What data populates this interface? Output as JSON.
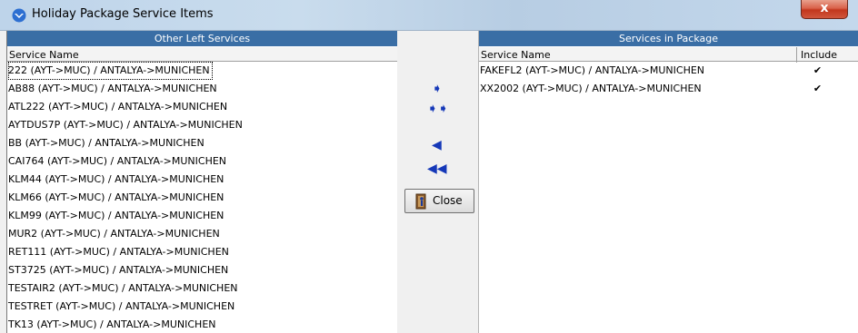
{
  "window": {
    "title": "Holiday Package Service Items",
    "close_glyph": "x"
  },
  "left_panel": {
    "group_title": "Other Left Services",
    "column_header": "Service Name",
    "rows": [
      "222 (AYT->MUC) / ANTALYA->MUNICHEN",
      "AB88 (AYT->MUC) / ANTALYA->MUNICHEN",
      "ATL222 (AYT->MUC) / ANTALYA->MUNICHEN",
      "AYTDUS7P (AYT->MUC) / ANTALYA->MUNICHEN",
      "BB (AYT->MUC) / ANTALYA->MUNICHEN",
      "CAI764 (AYT->MUC) / ANTALYA->MUNICHEN",
      "KLM44 (AYT->MUC) / ANTALYA->MUNICHEN",
      "KLM66 (AYT->MUC) / ANTALYA->MUNICHEN",
      "KLM99 (AYT->MUC) / ANTALYA->MUNICHEN",
      "MUR2 (AYT->MUC) / ANTALYA->MUNICHEN",
      "RET111 (AYT->MUC) / ANTALYA->MUNICHEN",
      "ST3725 (AYT->MUC) / ANTALYA->MUNICHEN",
      "TESTAIR2 (AYT->MUC) / ANTALYA->MUNICHEN",
      "TESTRET (AYT->MUC) / ANTALYA->MUNICHEN",
      "TK13 (AYT->MUC) / ANTALYA->MUNICHEN"
    ]
  },
  "right_panel": {
    "group_title": "Services in Package",
    "column_service": "Service Name",
    "column_include": "Include",
    "rows": [
      {
        "name": "FAKEFL2 (AYT->MUC) / ANTALYA->MUNICHEN",
        "include": "✔"
      },
      {
        "name": "XX2002 (AYT->MUC) / ANTALYA->MUNICHEN",
        "include": "✔"
      }
    ]
  },
  "buttons": {
    "add_one": "➧",
    "add_all": "➧➧",
    "remove_one": "◀",
    "remove_all": "◀◀",
    "close_label": "Close",
    "icons": {
      "add_one": "arrow-right-icon",
      "add_all": "double-arrow-right-icon",
      "remove_one": "arrow-left-icon",
      "remove_all": "double-arrow-left-icon",
      "close": "door-exit-icon"
    }
  },
  "colors": {
    "group_header": "#3a6ea5",
    "arrow": "#1538b8",
    "title_close": "#c8432a"
  }
}
